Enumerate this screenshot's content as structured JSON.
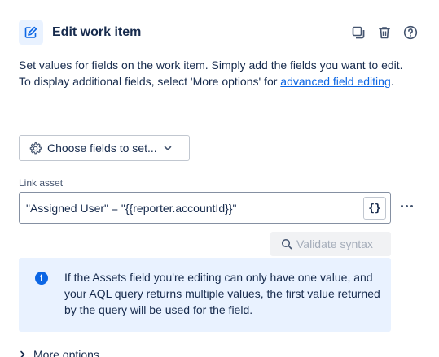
{
  "header": {
    "title": "Edit work item",
    "icon": "edit-pencil-icon",
    "actions": [
      "duplicate-icon",
      "delete-icon",
      "help-icon"
    ]
  },
  "description": {
    "line1": "Set values for fields on the work item. Simply add the fields you want to edit.",
    "line2_prefix": "To display additional fields, select 'More options' for ",
    "link": "advanced field editing",
    "line2_suffix": "."
  },
  "choose_fields": {
    "label": "Choose fields to set...",
    "icon": "gear-icon"
  },
  "link_asset": {
    "label": "Link asset",
    "value": "\"Assigned User\" = \"{{reporter.accountId}}\"",
    "smart_values_label": "{}"
  },
  "validate": {
    "label": "Validate syntax",
    "icon": "search-icon"
  },
  "info": {
    "text": "If the Assets field you're editing can only have one value, and your AQL query returns multiple values, the first value returned by the query will be used for the field."
  },
  "more_options": {
    "label": "More options"
  },
  "colors": {
    "accent": "#0c66e4",
    "info_bg": "#e9f2ff",
    "text": "#172b4d"
  }
}
